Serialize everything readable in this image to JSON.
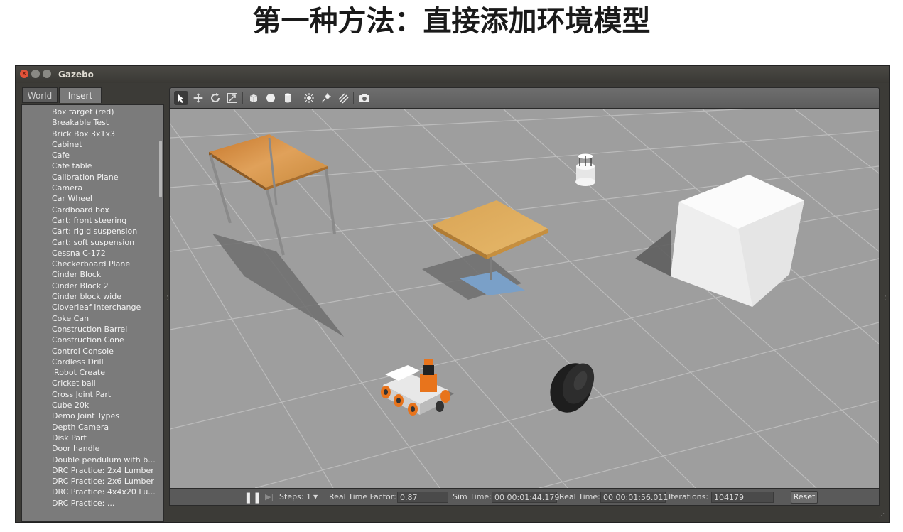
{
  "slide": {
    "title": "第一种方法：直接添加环境模型"
  },
  "window": {
    "title": "Gazebo"
  },
  "tabs": {
    "world": "World",
    "insert": "Insert"
  },
  "insert_list": [
    "Box target (red)",
    "Breakable Test",
    "Brick Box 3x1x3",
    "Cabinet",
    "Cafe",
    "Cafe table",
    "Calibration Plane",
    "Camera",
    "Car Wheel",
    "Cardboard box",
    "Cart: front steering",
    "Cart: rigid suspension",
    "Cart: soft suspension",
    "Cessna C-172",
    "Checkerboard Plane",
    "Cinder Block",
    "Cinder Block 2",
    "Cinder block wide",
    "Cloverleaf Interchange",
    "Coke Can",
    "Construction Barrel",
    "Construction Cone",
    "Control Console",
    "Cordless Drill",
    "iRobot Create",
    "Cricket ball",
    "Cross Joint Part",
    "Cube 20k",
    "Demo Joint Types",
    "Depth Camera",
    "Disk Part",
    "Door handle",
    "Double pendulum with b...",
    "DRC Practice: 2x4 Lumber",
    "DRC Practice: 2x6 Lumber",
    "DRC Practice: 4x4x20 Lu...",
    "DRC Practice: ..."
  ],
  "toolbar": {
    "icons": [
      "select-arrow",
      "translate",
      "rotate",
      "scale",
      "box",
      "sphere",
      "cylinder",
      "point-light",
      "spot-light",
      "directional-light",
      "screenshot"
    ]
  },
  "status": {
    "steps_label": "Steps:",
    "steps_value": "1",
    "rtf_label": "Real Time Factor:",
    "rtf_value": "0.87",
    "sim_time_label": "Sim Time:",
    "sim_time_value": "00 00:01:44.179",
    "real_time_label": "Real Time:",
    "real_time_value": "00 00:01:56.011",
    "iterations_label": "Iterations:",
    "iterations_value": "104179",
    "reset_label": "Reset"
  },
  "colors": {
    "ground": "#9e9e9e",
    "grid": "#bdbdbd",
    "wood": "#c98a3c",
    "robot_orange": "#e8741c"
  }
}
